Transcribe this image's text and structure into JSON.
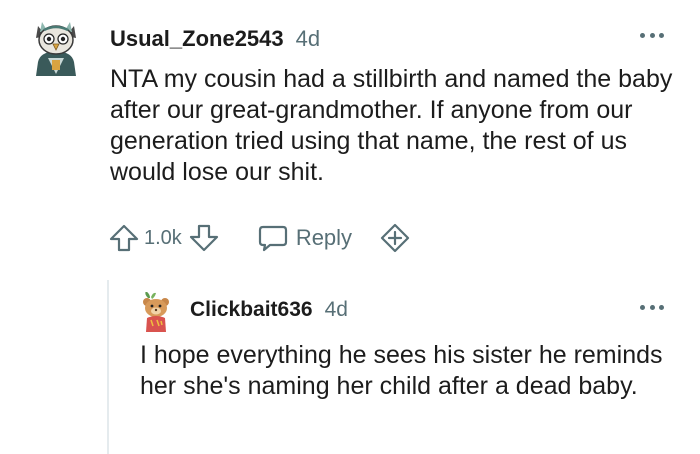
{
  "comment": {
    "username": "Usual_Zone2543",
    "timestamp": "4d",
    "body": "NTA my cousin had a stillbirth and named the baby after our great-grandmother. If anyone from our generation tried using that name, the rest of us would lose our shit.",
    "avatar_icon": "owl-avatar-icon",
    "votes": "1.0k",
    "reply_label": "Reply"
  },
  "reply": {
    "username": "Clickbait636",
    "timestamp": "4d",
    "body": "I hope everything he sees his sister he reminds her she's naming her child after a dead baby.",
    "avatar_icon": "bear-avatar-icon"
  },
  "colors": {
    "text": "#1c1c1c",
    "muted": "#576f76",
    "thread_line": "#e5ebee"
  }
}
